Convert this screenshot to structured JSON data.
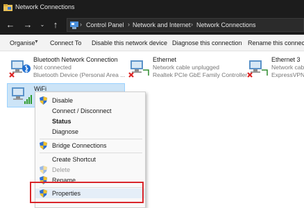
{
  "window": {
    "title": "Network Connections",
    "app_icon": "network-folder-icon"
  },
  "nav": {
    "back_icon": "arrow-left-icon",
    "forward_icon": "arrow-right-icon",
    "dropdown_icon": "chevron-down-icon",
    "up_icon": "arrow-up-icon"
  },
  "address": {
    "icon": "control-panel-icon",
    "crumbs": [
      "Control Panel",
      "Network and Internet",
      "Network Connections"
    ]
  },
  "toolbar": {
    "items": [
      "Organise",
      "Connect To",
      "Disable this network device",
      "Diagnose this connection",
      "Rename this connection"
    ]
  },
  "adapters": [
    {
      "name": "Bluetooth Network Connection",
      "status": "Not connected",
      "device": "Bluetooth Device (Personal Area ...",
      "icon": "bluetooth-adapter-icon"
    },
    {
      "name": "Ethernet",
      "status": "Network cable unplugged",
      "device": "Realtek PCIe GbE Family Controller",
      "icon": "ethernet-adapter-icon"
    },
    {
      "name": "Ethernet 3",
      "status": "Network cable u...",
      "device": "ExpressVPN",
      "icon": "ethernet-adapter-icon"
    },
    {
      "name": "WiFi",
      "status": "",
      "device": "",
      "icon": "wifi-adapter-icon"
    }
  ],
  "context_menu": {
    "items": [
      {
        "label": "Disable",
        "shield": true
      },
      {
        "label": "Connect / Disconnect"
      },
      {
        "label": "Status",
        "bold": true
      },
      {
        "label": "Diagnose"
      },
      {
        "label": "Bridge Connections",
        "shield": true
      },
      {
        "label": "Create Shortcut"
      },
      {
        "label": "Delete",
        "shield": true,
        "disabled": true
      },
      {
        "label": "Rename",
        "shield": true
      },
      {
        "label": "Properties",
        "shield": true,
        "highlighted": true
      }
    ]
  },
  "colors": {
    "highlight_box": "#d9262b",
    "selection": "#cce4f7",
    "title_bar": "#1c1c1c"
  }
}
